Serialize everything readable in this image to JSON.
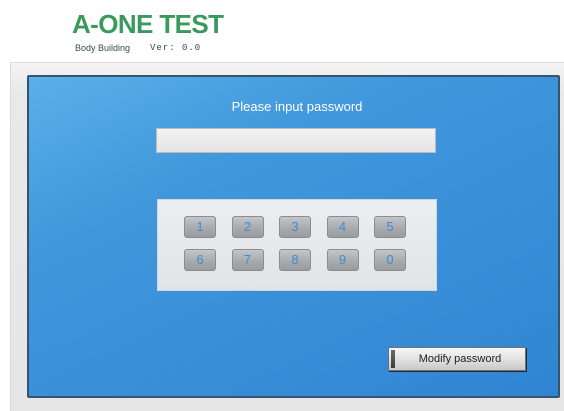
{
  "header": {
    "logo": "A-ONE TEST",
    "subtitle": "Body Building",
    "version": "Ver: 0.0"
  },
  "login": {
    "prompt": "Please input password",
    "password_value": "",
    "keypad": {
      "keys": [
        "1",
        "2",
        "3",
        "4",
        "5",
        "6",
        "7",
        "8",
        "9",
        "0"
      ]
    },
    "modify_button_label": "Modify password"
  },
  "colors": {
    "logo": "#3a9a5e",
    "panel_blue": "#3a90d8",
    "panel_border": "#35546f",
    "key_digit": "#3a8fd6",
    "key_face": "#a8aaad",
    "keypad_bg": "#e6e9ec"
  }
}
